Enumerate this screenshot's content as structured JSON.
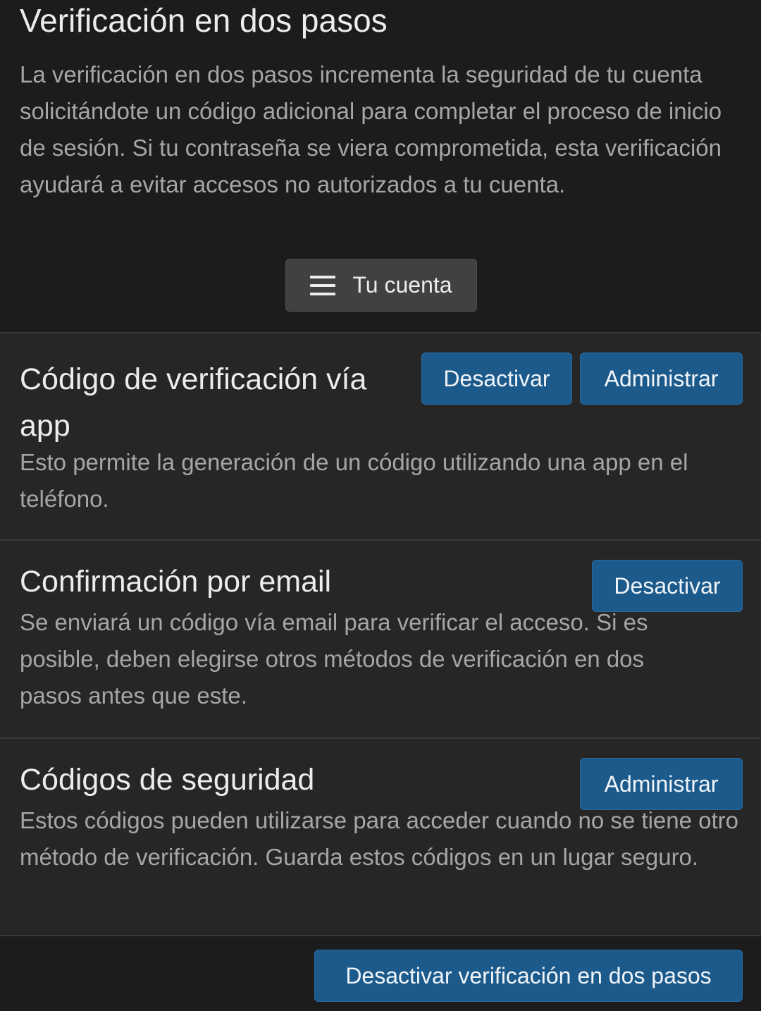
{
  "header": {
    "title": "Verificación en dos pasos",
    "intro": "La verificación en dos pasos incrementa la seguridad de tu cuenta solicitándote un código adicional para completar el proceso de inicio de sesión. Si tu contraseña se viera comprometida, esta verificación ayudará a evitar accesos no autorizados a tu cuenta.",
    "account_button_label": "Tu cuenta",
    "account_button_icon": "menu-icon"
  },
  "methods": [
    {
      "title": "Código de verificación vía app",
      "description": "Esto permite la generación de un código utilizando una app en el teléfono.",
      "buttons": [
        "Desactivar",
        "Administrar"
      ]
    },
    {
      "title": "Confirmación por email",
      "description": "Se enviará un código vía email para verificar el acceso. Si es posible, deben elegirse otros métodos de verificación en dos pasos antes que este.",
      "buttons": [
        "Desactivar"
      ]
    },
    {
      "title": "Códigos de seguridad",
      "description": "Estos códigos pueden utilizarse para acceder cuando no se tiene otro método de verificación. Guarda estos códigos en un lugar seguro.",
      "buttons": [
        "Administrar"
      ]
    }
  ],
  "footer": {
    "disable_all_label": "Desactivar verificación en dos pasos"
  },
  "colors": {
    "background": "#1c1c1d",
    "section_background": "#262627",
    "primary_button": "#1c5a8c",
    "secondary_button": "#414142",
    "text_primary": "#ececec",
    "text_muted": "#a6a6a8"
  }
}
